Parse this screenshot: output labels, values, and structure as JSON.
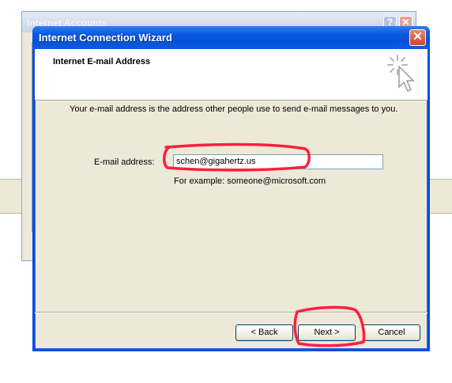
{
  "background_window": {
    "title": "Internet Accounts",
    "help_label": "?",
    "close_label": "✕"
  },
  "wizard": {
    "title": "Internet Connection Wizard",
    "close_label": "✕",
    "header_title": "Internet E-mail Address",
    "description": "Your e-mail address is the address other people use to send e-mail messages to you.",
    "email_label": "E-mail address:",
    "email_value": "schen@gigahertz.us",
    "example": "For example: someone@microsoft.com",
    "buttons": {
      "back": "< Back",
      "next": "Next >",
      "cancel": "Cancel"
    }
  },
  "colors": {
    "titlebar": "#0553d6",
    "dialog_bg": "#ece9d8",
    "annotation": "#ff1f3d"
  },
  "icons": {
    "wizard_header": "wizard-pointer-icon"
  }
}
